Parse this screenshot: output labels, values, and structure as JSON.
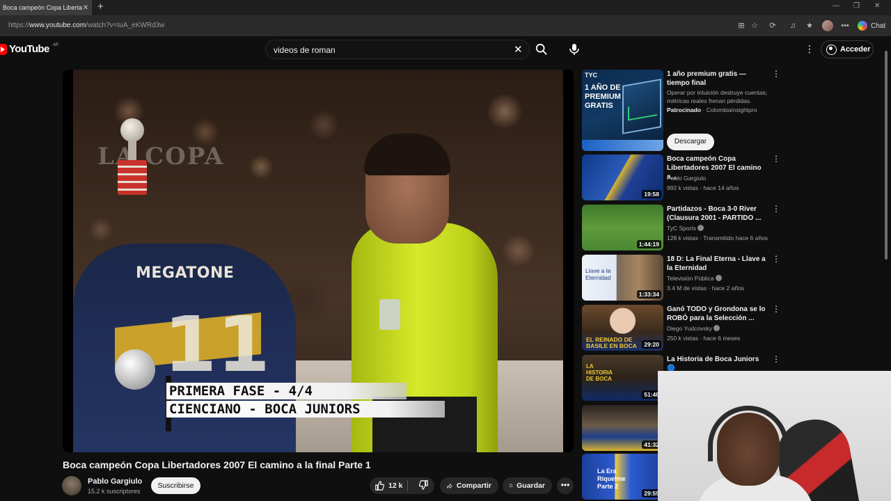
{
  "browser": {
    "tab_title": "Boca campeón Copa Libertado",
    "tab_close": "✕",
    "new_tab": "+",
    "window_controls": [
      "—",
      "❐",
      "✕"
    ],
    "url_prefix": "https://",
    "url_domain": "www.youtube.com",
    "url_path": "/watch?v=tuA_eKWRd3w",
    "toolbar_icons": [
      "⊞",
      "☆",
      "⟳",
      "♫",
      "★",
      "⧉",
      "•••"
    ],
    "chat_label": "Chat"
  },
  "header": {
    "logo_text": "YouTube",
    "country_code": "AR",
    "search_query": "videos de roman",
    "clear_icon": "✕",
    "more_icon": "⋮",
    "signin_label": "Acceder"
  },
  "player": {
    "jersey_text": "MEGATONE",
    "jersey_number": "11",
    "watermark": "LA COPA",
    "caption_line1": "PRIMERA FASE - 4/4",
    "caption_line2": "CIENCIANO - BOCA JUNIORS"
  },
  "video": {
    "title": "Boca campeón Copa Libertadores 2007 El camino a la final Parte 1",
    "channel": "Pablo Gargiulo",
    "subscribers": "15.2 k suscriptores",
    "subscribe_label": "Suscribirse",
    "likes": "12 k",
    "share_label": "Compartir",
    "save_label": "Guardar",
    "more_icon": "•••"
  },
  "sidebar": {
    "ad": {
      "thumb_brand": "TYC",
      "thumb_text": "1 AÑO DE PREMIUM GRATIS",
      "title": "1 año premium gratis — tiempo final",
      "description": "Operar por intuición destruye cuentas; métricas reales frenan pérdidas.",
      "sponsored_label": "Patrocinado",
      "advertiser": "· Colombiainsightpro",
      "cta": "Descargar"
    },
    "items": [
      {
        "title": "Boca campeón Copa Libertadores 2007 El camino a...",
        "channel": "Pablo Gargiulo",
        "meta": "992 k vistas · hace 14 años",
        "duration": "19:58",
        "verified": false
      },
      {
        "title": "Partidazos - Boca 3-0 River (Clausura 2001 - PARTIDO ...",
        "channel": "TyC Sports",
        "meta": "128 k vistas · Transmitido hace 6 años",
        "duration": "1:44:19",
        "verified": true
      },
      {
        "title": "18 D: La Final Eterna - Llave a la Eternidad",
        "channel": "Televisión Pública",
        "meta": "3.4 M de vistas · hace 2 años",
        "duration": "1:33:34",
        "verified": true
      },
      {
        "title": "Ganó TODO y Grondona se lo ROBÓ para la Selección ...",
        "channel": "Diego Yudcovsky",
        "meta": "250 k vistas · hace 6 meses",
        "duration": "29:20",
        "verified": true
      },
      {
        "title": "La Historia de Boca Juniors 🔵",
        "channel": "",
        "meta": "",
        "duration": "51:48",
        "verified": false
      },
      {
        "title": "",
        "channel": "",
        "meta": "",
        "duration": "41:32",
        "verified": false
      },
      {
        "title": "",
        "channel": "",
        "meta": "",
        "duration": "29:59",
        "verified": false
      }
    ],
    "thumb_texts": [
      "EL REINADO DE BASILE EN BOCA",
      "LA HISTORIA DE BOCA",
      "La Era Riquelme Parte 2",
      "Llave a la Eternidad"
    ]
  },
  "colors": {
    "background": "#0f0f0f",
    "brand_red": "#ff0000",
    "referee_shirt": "#c8dc20",
    "boca_blue": "#1f2d55",
    "boca_gold": "#c9a02a"
  }
}
